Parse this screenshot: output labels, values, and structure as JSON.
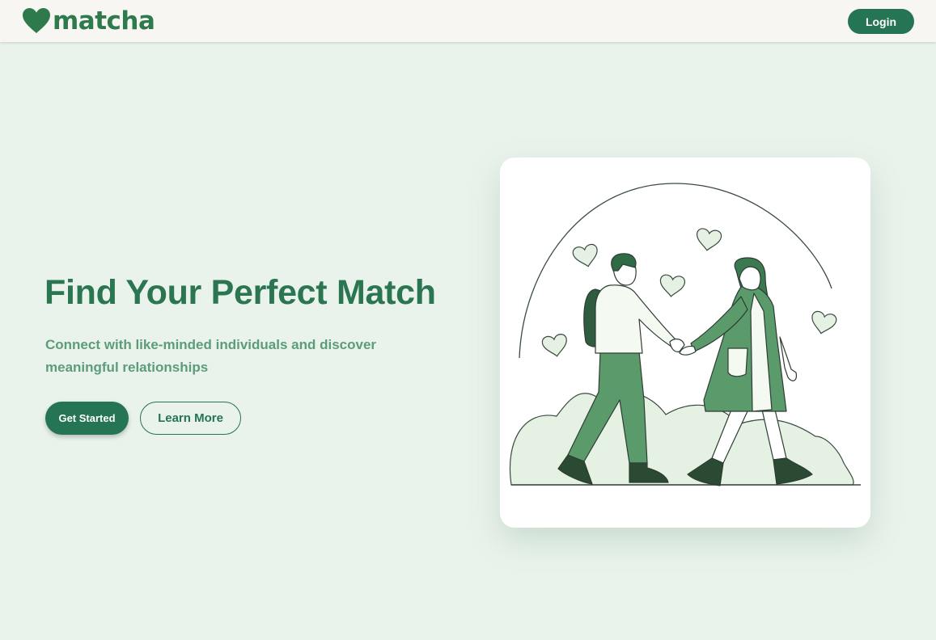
{
  "header": {
    "logo_text": "matcha",
    "logo_icon": "heart-icon",
    "login_label": "Login"
  },
  "hero": {
    "title": "Find Your Perfect Match",
    "subtitle": "Connect with like-minded individuals and discover meaningful relationships",
    "primary_button": "Get Started",
    "secondary_button": "Learn More"
  },
  "illustration": {
    "subject": "couple-holding-hands-illustration"
  },
  "colors": {
    "brand": "#2f7a4c",
    "button": "#257453",
    "background": "#e9f3ec",
    "header": "#f7f6f3",
    "subtitle": "#5d9c79"
  }
}
